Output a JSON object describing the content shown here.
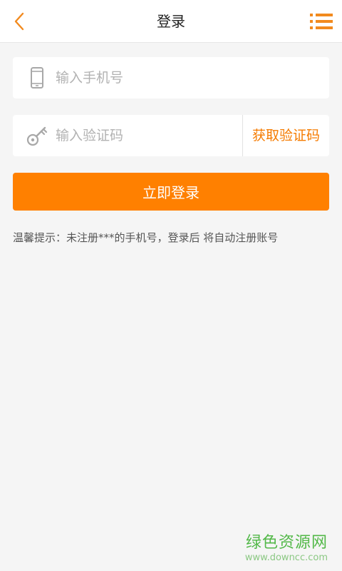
{
  "header": {
    "title": "登录",
    "back_icon": "chevron-left-icon",
    "menu_icon": "list-menu-icon"
  },
  "form": {
    "phone_placeholder": "输入手机号",
    "phone_icon": "mobile-phone-icon",
    "code_placeholder": "输入验证码",
    "code_icon": "key-icon",
    "get_code_label": "获取验证码",
    "submit_label": "立即登录"
  },
  "tip": "温馨提示：未注册***的手机号，登录后 将自动注册账号",
  "watermark": {
    "name": "绿色资源网",
    "url": "www.downcc.com"
  },
  "colors": {
    "accent": "#ff8000",
    "background": "#f5f5f5",
    "watermark": "#52b848"
  }
}
